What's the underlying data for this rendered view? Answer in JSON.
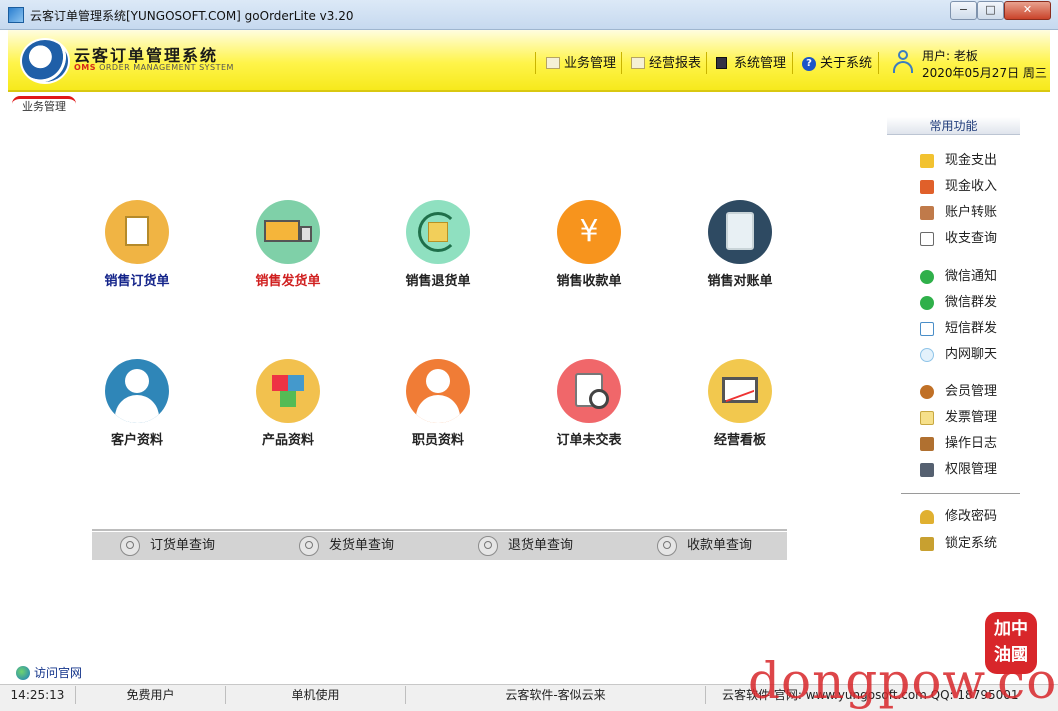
{
  "window": {
    "title": "云客订单管理系统[YUNGOSOFT.COM]  goOrderLite v3.20",
    "min_label": "−",
    "max_label": "□",
    "close_label": "✕"
  },
  "header": {
    "logo_title": "云客订单管理系统",
    "logo_sub_accent": "OMS",
    "logo_sub": " ORDER MANAGEMENT SYSTEM",
    "menu": [
      {
        "label": "业务管理",
        "icon": "folder-icon"
      },
      {
        "label": "经营报表",
        "icon": "report-icon"
      },
      {
        "label": "系统管理",
        "icon": "system-icon"
      },
      {
        "label": "关于系统",
        "icon": "help-icon"
      }
    ],
    "user": "用户: 老板",
    "date": "2020年05月27日  周三"
  },
  "tab": {
    "label": "业务管理"
  },
  "tiles": [
    {
      "label": "销售订货单",
      "icon": "order-doc-icon",
      "color": "#f0b444"
    },
    {
      "label": "销售发货单",
      "icon": "delivery-truck-icon",
      "color": "#7fd0a8"
    },
    {
      "label": "销售退货单",
      "icon": "return-icon",
      "color": "#8fe0c0"
    },
    {
      "label": "销售收款单",
      "icon": "yuan-icon",
      "glyph": "¥",
      "color": "#f7941d"
    },
    {
      "label": "销售对账单",
      "icon": "clipboard-icon",
      "color": "#2e4a62"
    },
    {
      "label": "客户资料",
      "icon": "customer-icon",
      "color": "#2f86b8"
    },
    {
      "label": "产品资料",
      "icon": "product-cubes-icon",
      "color": "#f2c14e"
    },
    {
      "label": "职员资料",
      "icon": "staff-icon",
      "color": "#f07c36"
    },
    {
      "label": "订单未交表",
      "icon": "pending-orders-icon",
      "color": "#f0676a"
    },
    {
      "label": "经营看板",
      "icon": "dashboard-icon",
      "color": "#f2c84e"
    }
  ],
  "queries": [
    {
      "label": "订货单查询"
    },
    {
      "label": "发货单查询"
    },
    {
      "label": "退货单查询"
    },
    {
      "label": "收款单查询"
    }
  ],
  "side_panel": {
    "title": "常用功能",
    "groups": [
      [
        {
          "label": "现金支出",
          "icon": "cash-out-icon",
          "color": "#f2c230"
        },
        {
          "label": "现金收入",
          "icon": "cash-in-icon",
          "color": "#e0602a"
        },
        {
          "label": "账户转账",
          "icon": "transfer-icon",
          "color": "#c07a4a"
        },
        {
          "label": "收支查询",
          "icon": "query-icon",
          "color": "#6a6a6a"
        }
      ],
      [
        {
          "label": "微信通知",
          "icon": "wechat-notify-icon",
          "color": "#2fb04a"
        },
        {
          "label": "微信群发",
          "icon": "wechat-broadcast-icon",
          "color": "#2fb04a"
        },
        {
          "label": "短信群发",
          "icon": "sms-icon",
          "color": "#4a8ec8"
        },
        {
          "label": "内网聊天",
          "icon": "chat-icon",
          "color": "#8fc4e8"
        }
      ],
      [
        {
          "label": "会员管理",
          "icon": "member-icon",
          "color": "#c0702a"
        },
        {
          "label": "发票管理",
          "icon": "invoice-icon",
          "color": "#f2d060"
        },
        {
          "label": "操作日志",
          "icon": "log-icon",
          "color": "#b07030"
        },
        {
          "label": "权限管理",
          "icon": "permission-icon",
          "color": "#556070"
        }
      ],
      [
        {
          "label": "修改密码",
          "icon": "key-icon",
          "color": "#e0b030"
        },
        {
          "label": "锁定系统",
          "icon": "lock-icon",
          "color": "#c8a030"
        }
      ]
    ]
  },
  "footer": {
    "visit_label": "访问官网",
    "status": [
      "14:25:13",
      "免费用户",
      "单机使用",
      "云客软件-客似云来",
      "云客软件 官网: www.yungosoft.com  QQ: 18795001"
    ]
  },
  "watermark": {
    "text": "dongpow.com",
    "seal": "加中油國"
  }
}
